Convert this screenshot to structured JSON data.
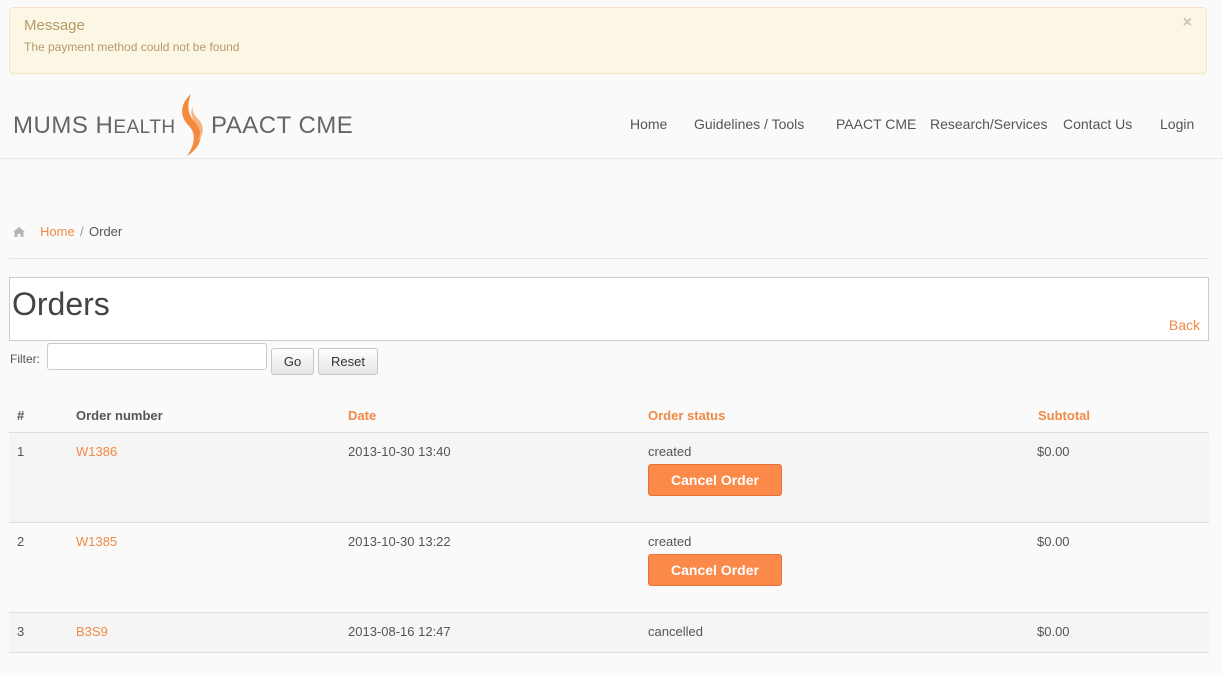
{
  "alert": {
    "title": "Message",
    "text": "The payment method could not be found",
    "close_glyph": "×"
  },
  "logo": {
    "part1_a": "MUMS H",
    "part1_b": "EALTH",
    "part2": "PAACT CME",
    "flame_color": "#f48a3e"
  },
  "nav": {
    "items": [
      {
        "label": "Home"
      },
      {
        "label": "Guidelines / Tools"
      },
      {
        "label": "PAACT CME"
      },
      {
        "label": "Research/Services"
      },
      {
        "label": "Contact Us"
      },
      {
        "label": "Login"
      }
    ]
  },
  "breadcrumb": {
    "home_label": "Home",
    "separator": "/",
    "current": "Order",
    "icon": "home-icon"
  },
  "page": {
    "title": "Orders",
    "back_label": "Back"
  },
  "filter": {
    "label": "Filter:",
    "value": "",
    "go_label": "Go",
    "reset_label": "Reset"
  },
  "table": {
    "headers": {
      "num": "#",
      "order_number": "Order number",
      "date": "Date",
      "status": "Order status",
      "subtotal": "Subtotal"
    },
    "rows": [
      {
        "num": "1",
        "order_number": "W1386",
        "date": "2013-10-30 13:40",
        "status": "created",
        "subtotal": "$0.00",
        "action": "Cancel Order"
      },
      {
        "num": "2",
        "order_number": "W1385",
        "date": "2013-10-30 13:22",
        "status": "created",
        "subtotal": "$0.00",
        "action": "Cancel Order"
      },
      {
        "num": "3",
        "order_number": "B3S9",
        "date": "2013-08-16 12:47",
        "status": "cancelled",
        "subtotal": "$0.00"
      }
    ]
  },
  "colors": {
    "accent": "#f08a46",
    "button": "#fb8a4a",
    "alert_bg": "#fcf7e4"
  }
}
